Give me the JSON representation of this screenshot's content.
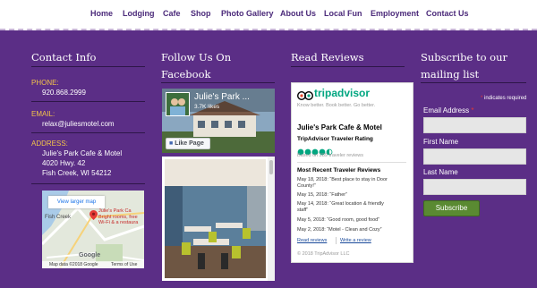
{
  "nav": [
    "Home",
    "Lodging",
    "Cafe",
    "Shop",
    "Photo Gallery",
    "About Us",
    "Local Fun",
    "Employment",
    "Contact Us"
  ],
  "contact": {
    "title": "Contact Info",
    "phone_label": "PHONE:",
    "phone": "920.868.2999",
    "email_label": "EMAIL:",
    "email": "relax@juliesmotel.com",
    "address_label": "ADDRESS:",
    "address": [
      "Julie's Park Cafe & Motel",
      "4020 Hwy. 42",
      "Fish Creek, WI 54212"
    ],
    "map": {
      "link": "View larger map",
      "town": "Fish Creek",
      "place_title": "Julie's Park Ca",
      "place_desc1": "Bright rooms, free",
      "place_desc2": "Wi-Fi & a restaura",
      "google": "Google",
      "footer": "Map data ©2018 Google",
      "terms": "Terms of Use"
    }
  },
  "facebook": {
    "title_lines": [
      "Follow Us On",
      "Facebook"
    ],
    "page_name": "Julie's Park ...",
    "likes": "3.7K likes",
    "like_btn": "Like Page"
  },
  "reviews": {
    "title": "Read Reviews",
    "ta_logo": "tripadvisor",
    "tagline": "Know better. Book better. Go better.",
    "property": "Julie's Park Cafe & Motel",
    "rating_title": "TripAdvisor Traveler Rating",
    "rating": 4.5,
    "based_on": "Based on 289 traveler reviews",
    "recent_title": "Most Recent Traveler Reviews",
    "items": [
      "May 18, 2018: “Best place to stay in Door",
      "County!”",
      "May 15, 2018: “Father”",
      "May 14, 2018: “Great location & friendly",
      "staff”",
      "May 5, 2018: “Good room, good food”",
      "May 2, 2018: “Motel - Clean and Cozy”"
    ],
    "read": "Read reviews",
    "write": "Write a review",
    "copyright": "© 2018 TripAdvisor LLC"
  },
  "subscribe": {
    "title_lines": [
      "Subscribe to our",
      "mailing list"
    ],
    "required_note": "indicates required",
    "asterisk": "*",
    "email_label": "Email Address",
    "first": "First Name",
    "last": "Last Name",
    "button": "Subscribe"
  },
  "colors": {
    "background": "#5b2e86",
    "nav_text": "#4b2a7a",
    "label": "#f3c34a",
    "button": "#5a8a32"
  }
}
